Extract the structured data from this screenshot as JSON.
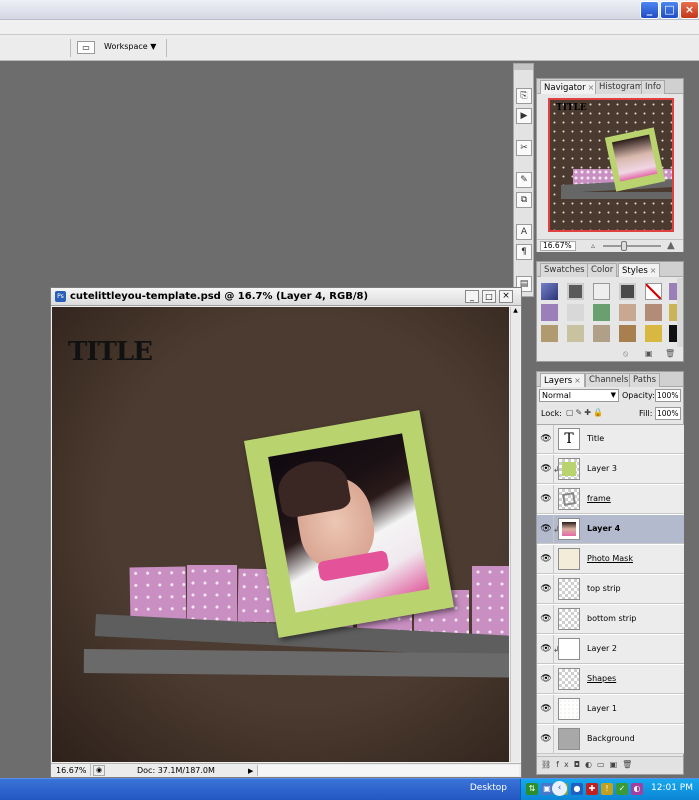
{
  "app": {
    "window_buttons": {
      "minimize": "_",
      "maximize": "□",
      "close": "×"
    },
    "options_bar": {
      "workspace_label": "Workspace"
    }
  },
  "document": {
    "title": "cutelittleyou-template.psd @ 16.7% (Layer 4, RGB/8)",
    "canvas_title_text": "TITLE",
    "zoom": "16.67%",
    "doc_info": "Doc: 37.1M/187.0M"
  },
  "navigator_panel": {
    "tabs": [
      "Navigator",
      "Histogram",
      "Info"
    ],
    "active_tab": "Navigator",
    "zoom": "16.67%",
    "preview_title_text": "TITLE"
  },
  "swatches_panel": {
    "tabs": [
      "Swatches",
      "Color",
      "Styles"
    ],
    "active_tab": "Styles"
  },
  "layers_panel": {
    "tabs": [
      "Layers",
      "Channels",
      "Paths"
    ],
    "active_tab": "Layers",
    "blend_mode": "Normal",
    "opacity_label": "Opacity:",
    "opacity_value": "100%",
    "lock_label": "Lock:",
    "fill_label": "Fill:",
    "fill_value": "100%",
    "layers": [
      {
        "name": "Title",
        "thumb": "text",
        "selected": false,
        "clipped": false,
        "underline": false
      },
      {
        "name": "Layer 3",
        "thumb": "green",
        "selected": false,
        "clipped": true,
        "underline": false
      },
      {
        "name": "frame",
        "thumb": "frame",
        "selected": false,
        "clipped": false,
        "underline": true
      },
      {
        "name": "Layer 4",
        "thumb": "photo",
        "selected": true,
        "clipped": true,
        "underline": false
      },
      {
        "name": "Photo Mask",
        "thumb": "mask",
        "selected": false,
        "clipped": false,
        "underline": true
      },
      {
        "name": "top strip",
        "thumb": "checker",
        "selected": false,
        "clipped": false,
        "underline": false
      },
      {
        "name": "bottom strip",
        "thumb": "checker",
        "selected": false,
        "clipped": false,
        "underline": false
      },
      {
        "name": "Layer 2",
        "thumb": "pink",
        "selected": false,
        "clipped": true,
        "underline": false
      },
      {
        "name": "Shapes",
        "thumb": "checker",
        "selected": false,
        "clipped": false,
        "underline": true
      },
      {
        "name": "Layer 1",
        "thumb": "brown",
        "selected": false,
        "clipped": false,
        "underline": false
      },
      {
        "name": "Background",
        "thumb": "gray",
        "selected": false,
        "clipped": false,
        "underline": false
      }
    ]
  },
  "taskbar": {
    "desktop_label": "Desktop",
    "time": "12:01 PM"
  },
  "colors": {
    "canvas_brown": "#4b3a2f",
    "frame_green": "#b9d36e",
    "strip_pink": "#c98fc2",
    "selected_layer": "#b4bacd",
    "taskbar_blue": "#2356c2"
  }
}
